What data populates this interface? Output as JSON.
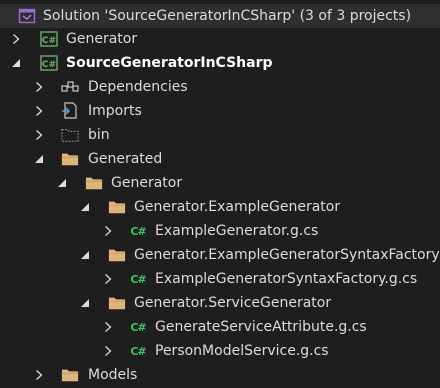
{
  "colors": {
    "background": "#1e1e1e",
    "selected_row": "#2f2f31",
    "text": "#dcdcdc",
    "folder": "#dcb67a",
    "csharp": "#3fbf6b",
    "project_icon": "#68b06a",
    "solution_icon": "#9b6bd3"
  },
  "solution": {
    "label": "Solution 'SourceGeneratorInCSharp' (3 of 3 projects)",
    "icon": "solution-icon"
  },
  "tree": [
    {
      "name": "project-generator",
      "label": "Generator",
      "arrow": "collapsed",
      "icon": "csharp-project-icon",
      "bold": false
    },
    {
      "name": "project-sourcegeneratorincsharp",
      "label": "SourceGeneratorInCSharp",
      "arrow": "expanded",
      "icon": "csharp-project-icon",
      "bold": true
    },
    {
      "name": "node-dependencies",
      "label": "Dependencies",
      "arrow": "collapsed",
      "icon": "dependencies-icon",
      "bold": false
    },
    {
      "name": "node-imports",
      "label": "Imports",
      "arrow": "collapsed",
      "icon": "imports-icon",
      "bold": false
    },
    {
      "name": "folder-bin",
      "label": "bin",
      "arrow": "collapsed",
      "icon": "hidden-folder-icon",
      "bold": false
    },
    {
      "name": "folder-generated",
      "label": "Generated",
      "arrow": "expanded",
      "icon": "folder-icon",
      "bold": false
    },
    {
      "name": "folder-generator",
      "label": "Generator",
      "arrow": "expanded",
      "icon": "folder-icon",
      "bold": false
    },
    {
      "name": "folder-generator-examplegenerator",
      "label": "Generator.ExampleGenerator",
      "arrow": "expanded",
      "icon": "folder-icon",
      "bold": false
    },
    {
      "name": "file-examplegenerator",
      "label": "ExampleGenerator.g.cs",
      "arrow": "collapsed",
      "icon": "csharp-file-icon",
      "bold": false
    },
    {
      "name": "folder-generator-examplegeneratorsyntaxfactory",
      "label": "Generator.ExampleGeneratorSyntaxFactory",
      "arrow": "expanded",
      "icon": "folder-icon",
      "bold": false
    },
    {
      "name": "file-examplegeneratorsyntaxfactory",
      "label": "ExampleGeneratorSyntaxFactory.g.cs",
      "arrow": "collapsed",
      "icon": "csharp-file-icon",
      "bold": false
    },
    {
      "name": "folder-generator-servicegenerator",
      "label": "Generator.ServiceGenerator",
      "arrow": "expanded",
      "icon": "folder-icon",
      "bold": false
    },
    {
      "name": "file-generateserviceattribute",
      "label": "GenerateServiceAttribute.g.cs",
      "arrow": "collapsed",
      "icon": "csharp-file-icon",
      "bold": false
    },
    {
      "name": "file-personmodelservice",
      "label": "PersonModelService.g.cs",
      "arrow": "collapsed",
      "icon": "csharp-file-icon",
      "bold": false
    },
    {
      "name": "folder-models",
      "label": "Models",
      "arrow": "collapsed",
      "icon": "folder-icon",
      "bold": false
    }
  ]
}
